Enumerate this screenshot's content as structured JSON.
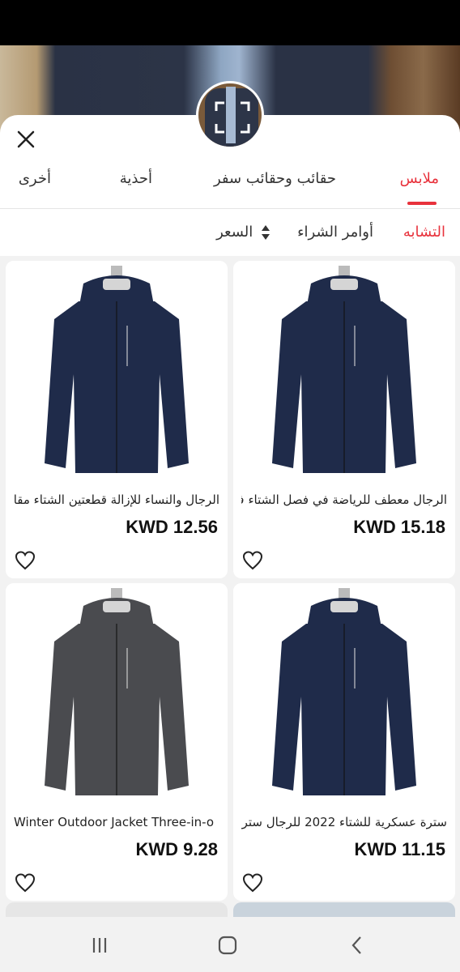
{
  "tabs": [
    {
      "label": "ملابس",
      "active": true
    },
    {
      "label": "حقائب وحقائب سفر",
      "active": false
    },
    {
      "label": "أحذية",
      "active": false
    },
    {
      "label": "أخرى",
      "active": false
    }
  ],
  "sort": {
    "similar": "التشابه",
    "orders": "أوامر الشراء",
    "price": "السعر"
  },
  "products": [
    {
      "title": "الرجال معطف للرياضة في فصل الشتاء ف",
      "price": "KWD 15.18",
      "color": "#1f2b4a"
    },
    {
      "title": "الرجال والنساء للإزالة قطعتين الشتاء مقا",
      "price": "KWD 12.56",
      "color": "#1f2b4a"
    },
    {
      "title": "سترة عسكرية للشتاء 2022 للرجال سترة",
      "price": "KWD 11.15",
      "color": "#1f2b4a"
    },
    {
      "title": "Winter Outdoor Jacket Three-in-o",
      "price": "KWD 9.28",
      "color": "#4a4b4f"
    }
  ],
  "icons": {
    "close": "close-icon",
    "heart": "heart-icon",
    "sort": "sort-arrows-icon",
    "recent": "recent-apps-icon",
    "home": "home-icon",
    "back": "back-icon"
  },
  "colors": {
    "accent": "#e8323c"
  }
}
